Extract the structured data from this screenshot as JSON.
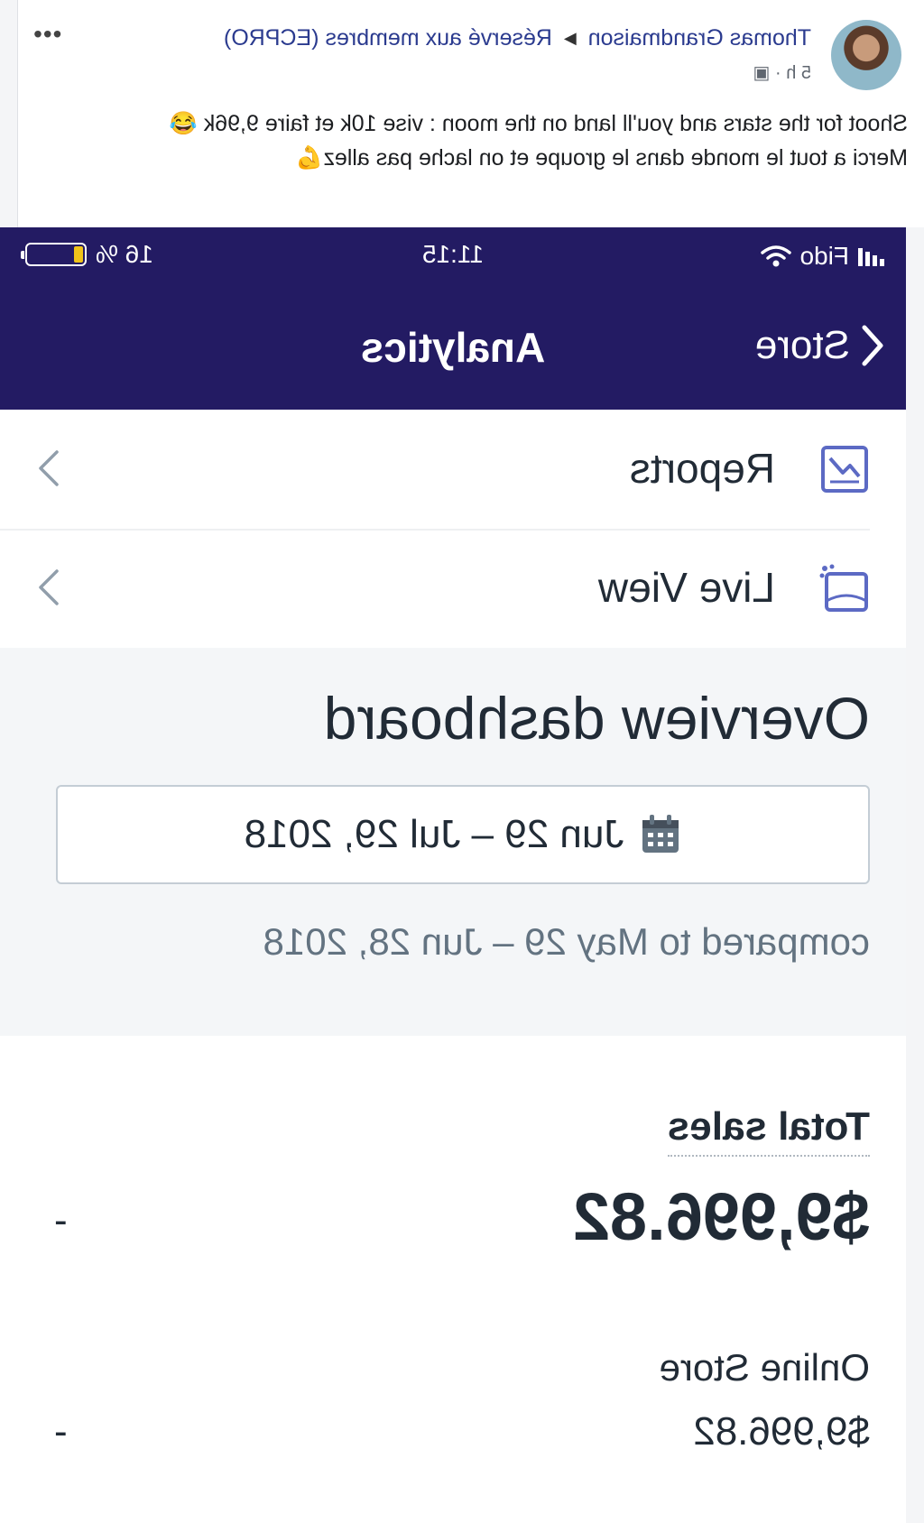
{
  "post": {
    "author": "Thomas Grandmaison",
    "group": "Réservé aux membres (ECPRO)",
    "time": "5 h",
    "line1": "Shoot for the stars and you'll land on the moon : vise 10k et faire 9,96k 😂",
    "line2": "Merci a tout le monde dans le groupe et on lache pas allez💪"
  },
  "status_bar": {
    "carrier": "Fido",
    "time": "11:15",
    "battery_text": "16 %",
    "battery_level": 0.16
  },
  "nav": {
    "back_label": "Store",
    "title": "Analytics"
  },
  "menu": [
    {
      "label": "Reports",
      "icon": "reports-icon"
    },
    {
      "label": "Live View",
      "icon": "live-view-icon"
    }
  ],
  "overview": {
    "title": "Overview dashboard",
    "date_range": "Jun 29 – Jul 29, 2018",
    "compared": "compared to May 29 – Jun 28, 2018"
  },
  "sales": {
    "label": "Total sales",
    "total": "$9,996.82",
    "change": "-",
    "channel_label": "Online Store",
    "channel_value": "$9,996.82",
    "channel_change": "-"
  },
  "colors": {
    "header": "#231b63",
    "icon": "#5c6ac4",
    "battery": "#f0c419",
    "author_link": "#2b3b8f"
  }
}
